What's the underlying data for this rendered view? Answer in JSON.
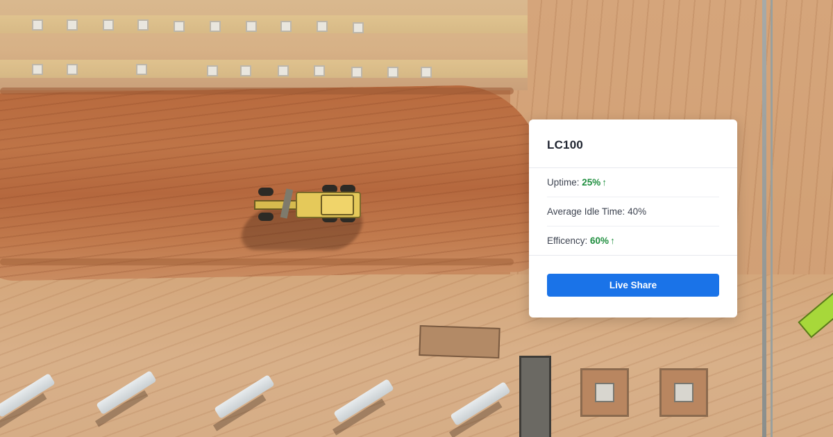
{
  "card": {
    "title": "LC100",
    "stats": [
      {
        "label": "Uptime: ",
        "value": "25%",
        "trend_icon": "arrow-up-icon",
        "trend_glyph": "↑",
        "highlight_color": "#1e8e3e"
      },
      {
        "label": "Average Idle Time: ",
        "value": "40%"
      },
      {
        "label": "Efficency: ",
        "value": "60%",
        "trend_icon": "arrow-up-icon",
        "trend_glyph": "↑",
        "highlight_color": "#1e8e3e"
      }
    ],
    "button_label": "Live Share",
    "button_color": "#1a73e8"
  }
}
